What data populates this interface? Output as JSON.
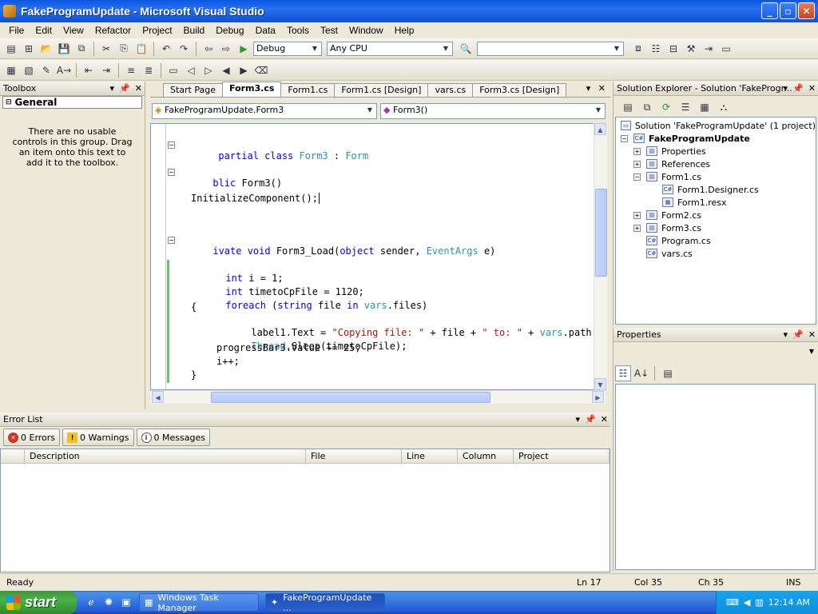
{
  "window": {
    "title": "FakeProgramUpdate - Microsoft Visual Studio"
  },
  "menu": [
    "File",
    "Edit",
    "View",
    "Refactor",
    "Project",
    "Build",
    "Debug",
    "Data",
    "Tools",
    "Test",
    "Window",
    "Help"
  ],
  "toolbar": {
    "config": "Debug",
    "platform": "Any CPU",
    "find_value": ""
  },
  "toolbox": {
    "title": "Toolbox",
    "group": "General",
    "empty_text": "There are no usable controls in this group. Drag an item onto this text to add it to the toolbox."
  },
  "editor": {
    "tabs": [
      "Start Page",
      "Form3.cs",
      "Form1.cs",
      "Form1.cs [Design]",
      "vars.cs",
      "Form3.cs [Design]"
    ],
    "active_tab": "Form3.cs",
    "class_combo": "FakeProgramUpdate.Form3",
    "member_combo": "Form3()",
    "lines": [
      "partial class Form3 : Form",
      "blic Form3()",
      "InitializeComponent();",
      "ivate void Form3_Load(object sender, EventArgs e)",
      "int i = 1;",
      "int timetoCpFile = 1120;",
      "foreach (string file in vars.files)",
      "{",
      "label1.Text = \"Copying file: \" + file + \" to: \" + vars.path",
      "Thread.Sleep(timetoCpFile);",
      "progressBar3.Value += 25;",
      "i++;",
      "}"
    ]
  },
  "solution_explorer": {
    "title": "Solution Explorer - Solution 'FakeProgr...",
    "solution": "Solution 'FakeProgramUpdate' (1 project)",
    "project": "FakeProgramUpdate",
    "items": [
      "Properties",
      "References",
      "Form1.cs",
      "Form1.Designer.cs",
      "Form1.resx",
      "Form2.cs",
      "Form3.cs",
      "Program.cs",
      "vars.cs"
    ]
  },
  "properties": {
    "title": "Properties"
  },
  "error_list": {
    "title": "Error List",
    "errors": "0 Errors",
    "warnings": "0 Warnings",
    "messages": "0 Messages",
    "columns": [
      "Description",
      "File",
      "Line",
      "Column",
      "Project"
    ]
  },
  "status": {
    "ready": "Ready",
    "ln": "Ln 17",
    "col": "Col 35",
    "ch": "Ch 35",
    "mode": "INS"
  },
  "taskbar": {
    "start": "start",
    "apps": [
      "Windows Task Manager",
      "FakeProgramUpdate ..."
    ],
    "clock": "12:14 AM"
  }
}
